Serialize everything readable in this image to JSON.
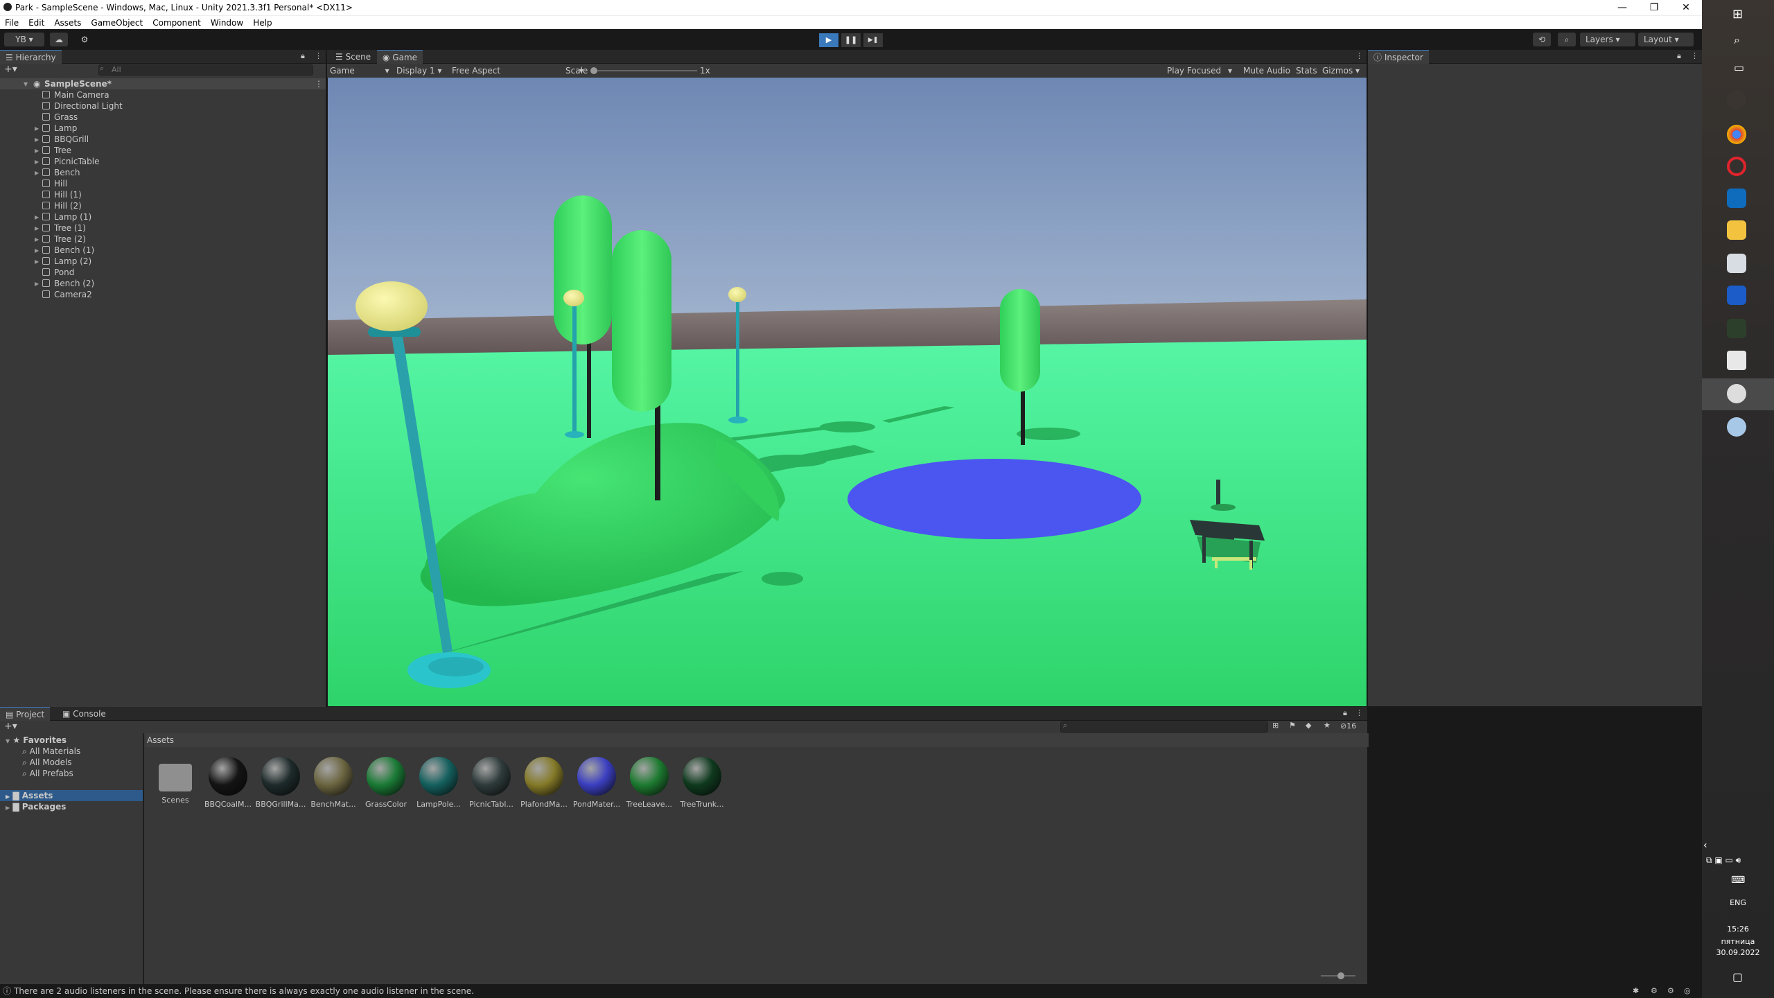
{
  "window": {
    "title": "Park - SampleScene - Windows, Mac, Linux - Unity 2021.3.3f1 Personal* <DX11>",
    "minimize": "—",
    "restore": "❐",
    "close": "✕"
  },
  "menu": [
    "File",
    "Edit",
    "Assets",
    "GameObject",
    "Component",
    "Window",
    "Help"
  ],
  "toolbar": {
    "account": "YB ▾",
    "cloud_icon": "cloud-icon",
    "settings_icon": "gear-icon",
    "play": "▶",
    "pause": "❚❚",
    "step": "▶❚",
    "layers": "Layers",
    "layout": "Layout"
  },
  "hierarchy": {
    "tab": "Hierarchy",
    "search_placeholder": "All",
    "scene": "SampleScene*",
    "items": [
      {
        "label": "Main Camera",
        "expandable": false
      },
      {
        "label": "Directional Light",
        "expandable": false
      },
      {
        "label": "Grass",
        "expandable": false
      },
      {
        "label": "Lamp",
        "expandable": true
      },
      {
        "label": "BBQGrill",
        "expandable": true
      },
      {
        "label": "Tree",
        "expandable": true
      },
      {
        "label": "PicnicTable",
        "expandable": true
      },
      {
        "label": "Bench",
        "expandable": true
      },
      {
        "label": "Hill",
        "expandable": false
      },
      {
        "label": "Hill (1)",
        "expandable": false
      },
      {
        "label": "Hill (2)",
        "expandable": false
      },
      {
        "label": "Lamp (1)",
        "expandable": true
      },
      {
        "label": "Tree (1)",
        "expandable": true
      },
      {
        "label": "Tree (2)",
        "expandable": true
      },
      {
        "label": "Bench (1)",
        "expandable": true
      },
      {
        "label": "Lamp (2)",
        "expandable": true
      },
      {
        "label": "Pond",
        "expandable": false
      },
      {
        "label": "Bench (2)",
        "expandable": true
      },
      {
        "label": "Camera2",
        "expandable": false
      }
    ]
  },
  "view_tabs": {
    "scene": "Scene",
    "game": "Game"
  },
  "game_toolbar": {
    "mode": "Game",
    "display": "Display 1",
    "aspect": "Free Aspect",
    "scale_label": "Scale",
    "scale_value": "1x",
    "play_focused": "Play Focused",
    "mute_audio": "Mute Audio",
    "stats": "Stats",
    "gizmos": "Gizmos"
  },
  "inspector": {
    "tab": "Inspector"
  },
  "project": {
    "tab_project": "Project",
    "tab_console": "Console",
    "favorites": "Favorites",
    "favorite_items": [
      "All Materials",
      "All Models",
      "All Prefabs"
    ],
    "assets_root": "Assets",
    "packages_root": "Packages",
    "breadcrumb": "Assets",
    "hidden_count": "16",
    "assets": [
      {
        "label": "Scenes",
        "type": "folder",
        "color": "#8f8f8f"
      },
      {
        "label": "BBQCoalM...",
        "type": "material",
        "color": "#141414"
      },
      {
        "label": "BBQGrillMa...",
        "type": "material",
        "color": "#1e2a2a"
      },
      {
        "label": "BenchMat...",
        "type": "material",
        "color": "#6b6540"
      },
      {
        "label": "GrassColor",
        "type": "material",
        "color": "#1a7a35"
      },
      {
        "label": "LampPole...",
        "type": "material",
        "color": "#14605e"
      },
      {
        "label": "PicnicTabl...",
        "type": "material",
        "color": "#2e3a3a"
      },
      {
        "label": "PlafondMa...",
        "type": "material",
        "color": "#857a28"
      },
      {
        "label": "PondMater...",
        "type": "material",
        "color": "#3b3fc0"
      },
      {
        "label": "TreeLeave...",
        "type": "material",
        "color": "#1d7a30"
      },
      {
        "label": "TreeTrunk...",
        "type": "material",
        "color": "#0f3a1e"
      }
    ]
  },
  "status": {
    "message": "There are 2 audio listeners in the scene. Please ensure there is always exactly one audio listener in the scene."
  },
  "taskbar": {
    "language": "ENG",
    "time": "15:26",
    "day": "пятница",
    "date": "30.09.2022"
  },
  "colors": {
    "accent": "#3a79bb",
    "grass": "#33e07a",
    "pond": "#4b55f0",
    "lamp_pole": "#2aa8b0",
    "lamp_light": "#f0ee90",
    "tree": "#44dd6a"
  }
}
